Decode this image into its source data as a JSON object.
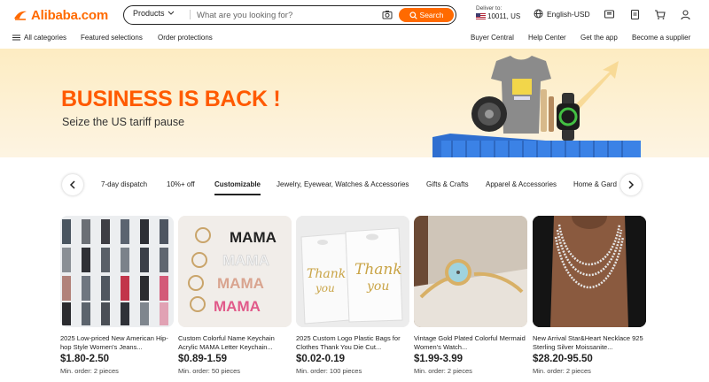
{
  "header": {
    "logo_text": "Alibaba.com",
    "search": {
      "category": "Products",
      "placeholder": "What are you looking for?",
      "button_label": "Search"
    },
    "deliver": {
      "label": "Deliver to:",
      "zip": "10011, US"
    },
    "language": "English-USD"
  },
  "nav": {
    "all_categories": "All categories",
    "featured": "Featured selections",
    "protections": "Order protections",
    "buyer_central": "Buyer Central",
    "help_center": "Help Center",
    "get_app": "Get the app",
    "supplier": "Become a supplier"
  },
  "banner": {
    "title": "BUSINESS IS BACK !",
    "subtitle": "Seize the US tariff pause"
  },
  "categories": {
    "tabs": [
      "7-day dispatch",
      "10%+ off",
      "Customizable",
      "Jewelry, Eyewear, Watches & Accessories",
      "Gifts & Crafts",
      "Apparel & Accessories",
      "Home & Gard"
    ],
    "active_index": 2
  },
  "products": [
    {
      "title": "2025 Low-priced New American Hip-hop Style Women's Jeans...",
      "price": "$1.80-2.50",
      "moq": "Min. order: 2 pieces"
    },
    {
      "title": "Custom Colorful Name Keychain Acrylic MAMA Letter Keychain...",
      "price": "$0.89-1.59",
      "moq": "Min. order: 50 pieces"
    },
    {
      "title": "2025 Custom Logo Plastic Bags for Clothes Thank You Die Cut...",
      "price": "$0.02-0.19",
      "moq": "Min. order: 100 pieces"
    },
    {
      "title": "Vintage Gold Plated Colorful Mermaid Women's Watch...",
      "price": "$1.99-3.99",
      "moq": "Min. order: 2 pieces"
    },
    {
      "title": "New Arrival Star&Heart Necklace 925 Sterling Silver Moissanite...",
      "price": "$28.20-95.50",
      "moq": "Min. order: 2 pieces"
    }
  ],
  "image_text": {
    "keychain_word": "MAMA",
    "bag_text_1": "Thank",
    "bag_text_2": "you"
  },
  "colors": {
    "brand": "#ff6a00",
    "banner_title": "#ff5a00"
  }
}
